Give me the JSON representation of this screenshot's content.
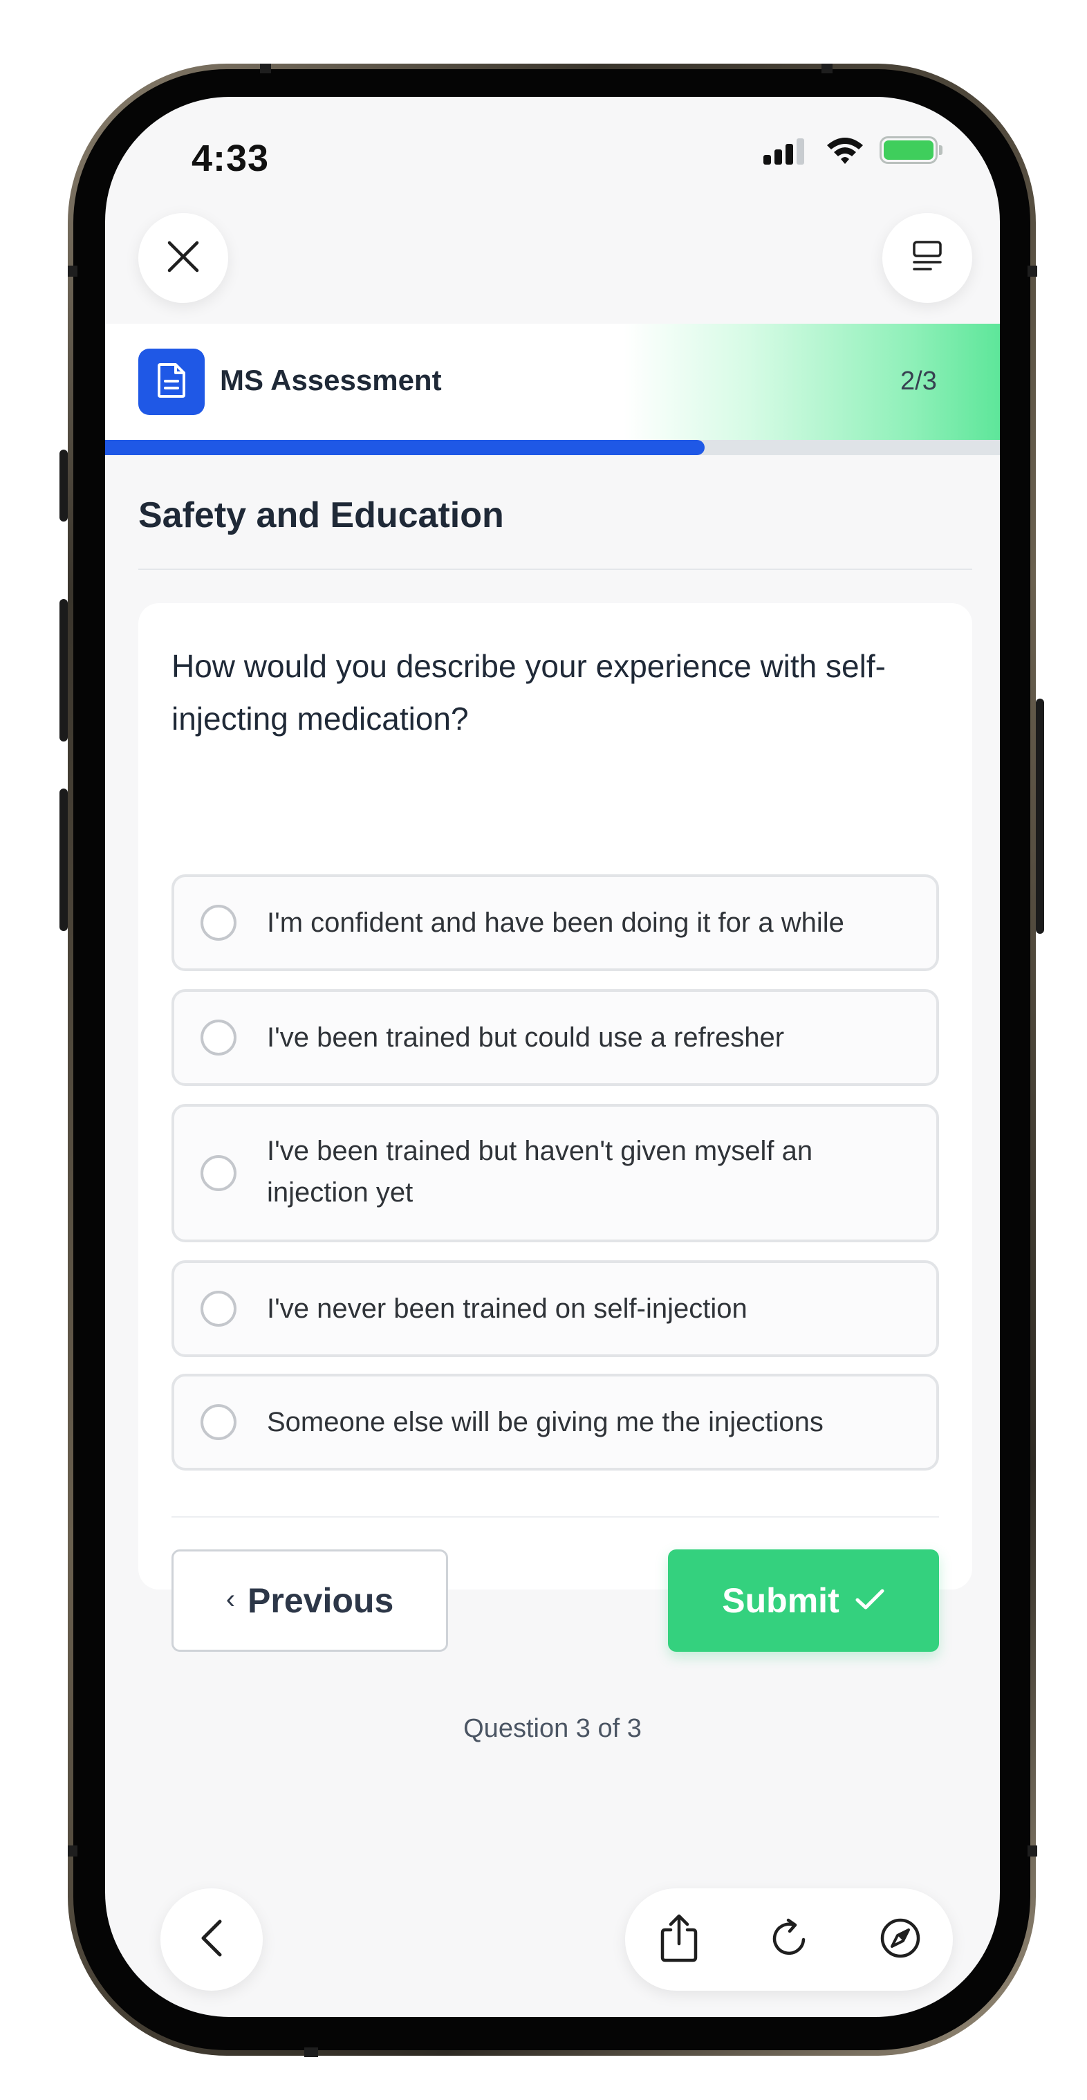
{
  "status_bar": {
    "time": "4:33"
  },
  "nav": {
    "close_label": "close",
    "menu_label": "menu"
  },
  "header": {
    "title": "MS Assessment",
    "step": "2/3",
    "progress_fraction": 0.67
  },
  "section": {
    "title": "Safety and Education"
  },
  "question": {
    "text": "How would you describe your experience with self-injecting medication?",
    "options": [
      {
        "label": "I'm confident and have been doing it for a while",
        "selected": false
      },
      {
        "label": "I've been trained but could use a refresher",
        "selected": false
      },
      {
        "label": "I've been trained but haven't given myself an injection yet",
        "selected": false
      },
      {
        "label": "I've never been trained on self-injection",
        "selected": false
      },
      {
        "label": "Someone else will be giving me the injections",
        "selected": false
      }
    ]
  },
  "actions": {
    "previous_label": "Previous",
    "submit_label": "Submit"
  },
  "footer": {
    "question_count": "Question 3 of 3"
  },
  "colors": {
    "accent": "#1f58e6",
    "submit": "#34d17e",
    "header_gradient_end": "#5ee69a"
  },
  "icons": {
    "close": "close-icon",
    "menu": "menu-icon",
    "document": "document-icon",
    "back": "chevron-left-icon",
    "share": "share-icon",
    "reload": "reload-icon",
    "compass": "compass-icon"
  }
}
